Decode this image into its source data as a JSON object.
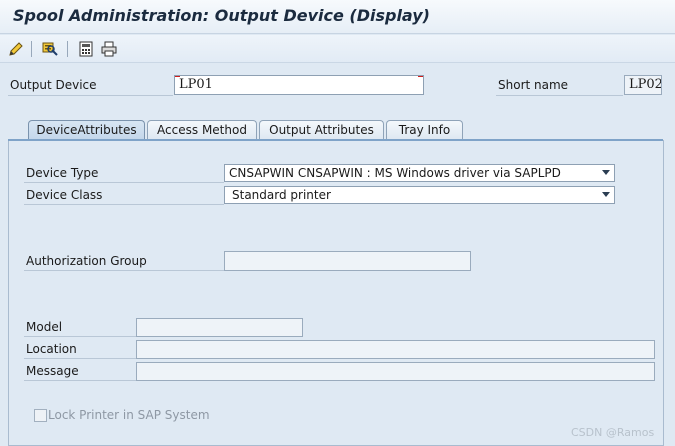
{
  "window": {
    "title": "Spool Administration: Output Device (Display)"
  },
  "toolbar": {
    "items": [
      {
        "icon": "pencil-icon"
      },
      {
        "icon": "device-info-icon"
      },
      {
        "icon": "calculator-icon"
      },
      {
        "icon": "printer-icon"
      }
    ]
  },
  "header": {
    "output_device_label": "Output Device",
    "output_device_value": "LP01",
    "short_name_label": "Short name",
    "short_name_value": "LP02"
  },
  "tabs": [
    {
      "label": "DeviceAttributes",
      "active": true
    },
    {
      "label": "Access Method",
      "active": false
    },
    {
      "label": "Output Attributes",
      "active": false
    },
    {
      "label": "Tray Info",
      "active": false
    }
  ],
  "attributes": {
    "device_type_label": "Device Type",
    "device_type_value": "CNSAPWIN CNSAPWIN : MS Windows driver via SAPLPD",
    "device_class_label": "Device Class",
    "device_class_value": "Standard printer",
    "authorization_group_label": "Authorization Group",
    "authorization_group_value": "",
    "model_label": "Model",
    "model_value": "",
    "location_label": "Location",
    "location_value": "",
    "message_label": "Message",
    "message_value": "",
    "lock_printer_label": "Lock Printer in SAP System",
    "lock_printer_checked": false
  },
  "watermark": "CSDN @Ramos"
}
